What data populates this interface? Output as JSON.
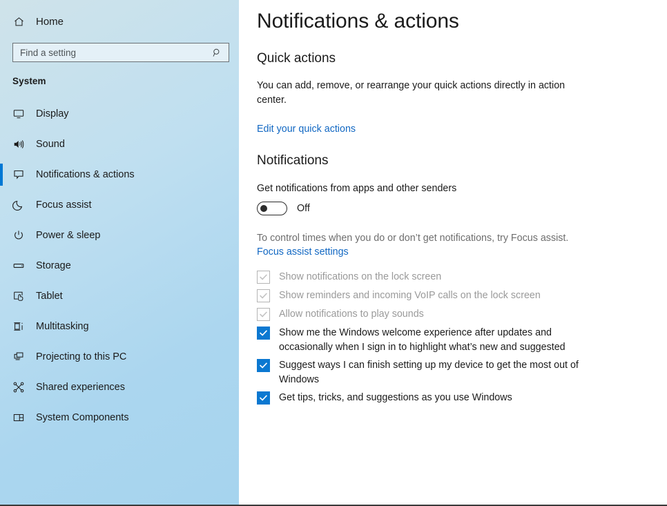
{
  "sidebar": {
    "home": {
      "label": "Home",
      "icon": "home-icon"
    },
    "search": {
      "value": "",
      "placeholder": "Find a setting",
      "icon": "search-icon"
    },
    "group_title": "System",
    "items": [
      {
        "label": "Display",
        "icon": "monitor-icon",
        "selected": false
      },
      {
        "label": "Sound",
        "icon": "speaker-icon",
        "selected": false
      },
      {
        "label": "Notifications & actions",
        "icon": "chat-bubble-icon",
        "selected": true
      },
      {
        "label": "Focus assist",
        "icon": "moon-icon",
        "selected": false
      },
      {
        "label": "Power & sleep",
        "icon": "power-icon",
        "selected": false
      },
      {
        "label": "Storage",
        "icon": "drive-icon",
        "selected": false
      },
      {
        "label": "Tablet",
        "icon": "tablet-touch-icon",
        "selected": false
      },
      {
        "label": "Multitasking",
        "icon": "multitasking-icon",
        "selected": false
      },
      {
        "label": "Projecting to this PC",
        "icon": "project-screen-icon",
        "selected": false
      },
      {
        "label": "Shared experiences",
        "icon": "share-nodes-icon",
        "selected": false
      },
      {
        "label": "System Components",
        "icon": "components-icon",
        "selected": false
      }
    ]
  },
  "main": {
    "page_title": "Notifications & actions",
    "quick_actions": {
      "heading": "Quick actions",
      "description": "You can add, remove, or rearrange your quick actions directly in action center.",
      "link": "Edit your quick actions"
    },
    "notifications": {
      "heading": "Notifications",
      "toggle_label": "Get notifications from apps and other senders",
      "toggle_state": "Off",
      "toggle_on": false,
      "focus_note": "To control times when you do or don’t get notifications, try Focus assist.",
      "focus_link": "Focus assist settings",
      "checkboxes": [
        {
          "label": "Show notifications on the lock screen",
          "checked": true,
          "disabled": true
        },
        {
          "label": "Show reminders and incoming VoIP calls on the lock screen",
          "checked": true,
          "disabled": true
        },
        {
          "label": "Allow notifications to play sounds",
          "checked": true,
          "disabled": true
        },
        {
          "label": "Show me the Windows welcome experience after updates and occasionally when I sign in to highlight what’s new and suggested",
          "checked": true,
          "disabled": false
        },
        {
          "label": "Suggest ways I can finish setting up my device to get the most out of Windows",
          "checked": true,
          "disabled": false
        },
        {
          "label": "Get tips, tricks, and suggestions as you use Windows",
          "checked": true,
          "disabled": false
        }
      ]
    }
  },
  "colors": {
    "accent": "#0078d4",
    "link": "#1268c3",
    "checkbox_checked": "#0b78d1",
    "sidebar_top": "#cfe3ea",
    "sidebar_bottom": "#a6d4ee",
    "text": "#1b1b1b",
    "muted": "#6e6e6e"
  }
}
